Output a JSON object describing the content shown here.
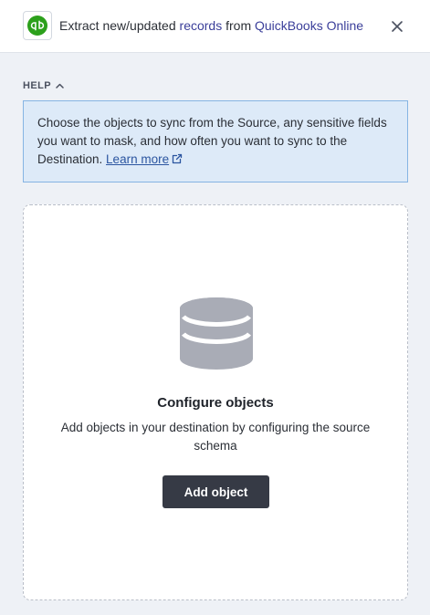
{
  "header": {
    "title_prefix": "Extract new/updated ",
    "title_link1": "records",
    "title_middle": " from ",
    "title_link2": "QuickBooks Online",
    "logo_icon": "quickbooks-logo",
    "close_icon": "close-icon"
  },
  "help": {
    "toggle_label": "HELP",
    "toggle_icon": "chevron-up-icon",
    "text": "Choose the objects to sync from the Source, any sensitive fields you want to mask, and how often you want to sync to the Destination. ",
    "learn_more": "Learn more",
    "learn_more_icon": "external-link-icon"
  },
  "config": {
    "icon": "database-icon",
    "title": "Configure objects",
    "description": "Add objects in your destination by configuring the source schema",
    "button_label": "Add object"
  },
  "colors": {
    "brand_green": "#2ca01c",
    "link": "#3b3f9a",
    "help_bg": "#ddeaf8",
    "help_border": "#86b4e3",
    "button_bg": "#363a45",
    "page_bg": "#eef1f6"
  }
}
